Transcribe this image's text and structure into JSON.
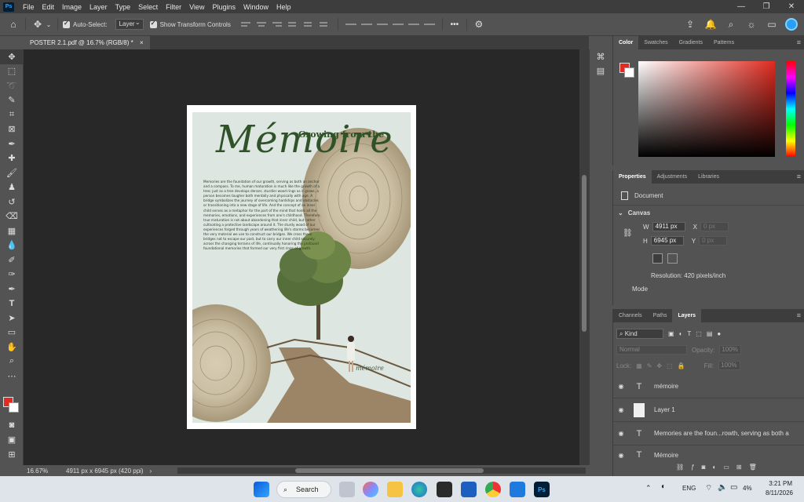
{
  "app": {
    "logo": "Ps",
    "window_controls": [
      "—",
      "❐",
      "✕"
    ]
  },
  "menu": [
    "File",
    "Edit",
    "Image",
    "Layer",
    "Type",
    "Select",
    "Filter",
    "View",
    "Plugins",
    "Window",
    "Help"
  ],
  "options": {
    "auto_select_label": "Auto-Select:",
    "auto_select_value": "Layer",
    "show_transform_label": "Show Transform Controls",
    "more": "•••"
  },
  "document": {
    "tab_title": "POSTER 2.1.pdf @ 16.7% (RGB/8) *",
    "close": "×"
  },
  "status": {
    "zoom": "16.67%",
    "info": "4911 px x 6945 px (420 ppi)",
    "arrow": "›"
  },
  "poster": {
    "title_small": "Growing from the",
    "title_large": "Mémoire",
    "signature": "mémoire",
    "body": "Memories are the foundation of our growth, serving as both an anchor and a compass. To me, human maturation is much like the growth of a tree; just as a tree develops denser, sturdier wood rings as it grows, a person becomes tougher both mentally and physically with age. A bridge symbolizes the journey of overcoming hardships and obstacles or transitioning into a new stage of life. And the concept of an inner child serves as a metaphor for the part of the mind that holds all the memories, emotions, and experiences from one's childhood. Therefore, true maturation is not about abandoning that inner child, but rather cultivating a protective landscape around it. The sturdy wood of our experiences forged through years of weathering life's storms becomes the very material we use to construct our bridges. We cross these bridges not to escape our past, but to carry our inner child securely across the changing terrains of life, continually honoring the profound foundational memories that formed our very first rings of growth."
  },
  "color_panel": {
    "tabs": [
      "Color",
      "Swatches",
      "Gradients",
      "Patterns"
    ],
    "foreground": "#e02b20",
    "background": "#ffffff"
  },
  "properties": {
    "tabs": [
      "Properties",
      "Adjustments",
      "Libraries"
    ],
    "document_label": "Document",
    "canvas_label": "Canvas",
    "w_label": "W",
    "w_value": "4911 px",
    "h_label": "H",
    "h_value": "6945 px",
    "x_label": "X",
    "x_placeholder": "0 px",
    "y_label": "Y",
    "y_placeholder": "0 px",
    "resolution": "Resolution: 420 pixels/inch",
    "mode_label": "Mode"
  },
  "layers": {
    "tabs": [
      "Channels",
      "Paths",
      "Layers"
    ],
    "filter_kind": "Kind",
    "blend_mode": "Normal",
    "opacity_label": "Opacity:",
    "opacity_value": "100%",
    "lock_label": "Lock:",
    "fill_label": "Fill:",
    "fill_value": "100%",
    "items": [
      {
        "type": "T",
        "name": "mémoire"
      },
      {
        "type": "raster",
        "name": "Layer 1"
      },
      {
        "type": "T",
        "name": "Memories are the foun...rowth, serving as both a"
      },
      {
        "type": "T",
        "name": "Mémoire"
      }
    ]
  },
  "taskbar": {
    "search_label": "Search",
    "lang": "ENG",
    "battery": "4%",
    "time": "3:21 PM",
    "date": "8/11/2026"
  }
}
